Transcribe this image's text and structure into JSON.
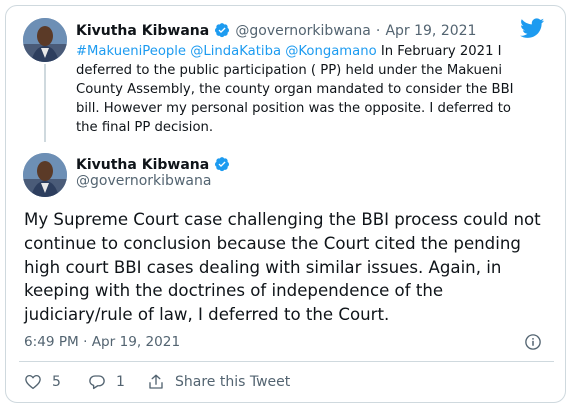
{
  "reply": {
    "author_name": "Kivutha Kibwana",
    "author_handle": "@governorkibwana",
    "separator": "·",
    "date": "Apr 19, 2021",
    "mentions": "#MakueniPeople @LindaKatiba @Kongamano",
    "text": " In February 2021 I deferred to the public participation ( PP) held under the Makueni County Assembly, the county organ mandated to consider the BBI bill. However my personal position was the opposite. I deferred to the final PP decision."
  },
  "main": {
    "author_name": "Kivutha Kibwana",
    "author_handle": "@governorkibwana",
    "text": "My  Supreme Court case challenging the BBI process could not continue to conclusion because the Court cited the pending high court BBI cases dealing with similar issues. Again, in keeping with the doctrines of independence of the judiciary/rule of law, I deferred to the Court.",
    "timestamp": "6:49 PM · Apr 19, 2021"
  },
  "actions": {
    "like_count": "5",
    "reply_count": "1",
    "share_label": "Share this Tweet"
  },
  "colors": {
    "accent": "#1d9bf0",
    "text": "#0f1419",
    "secondary": "#536471",
    "border": "#cfd9de"
  },
  "icons": [
    "twitter-bird-icon",
    "verified-badge-icon",
    "info-icon",
    "heart-icon",
    "comment-icon",
    "share-icon"
  ]
}
